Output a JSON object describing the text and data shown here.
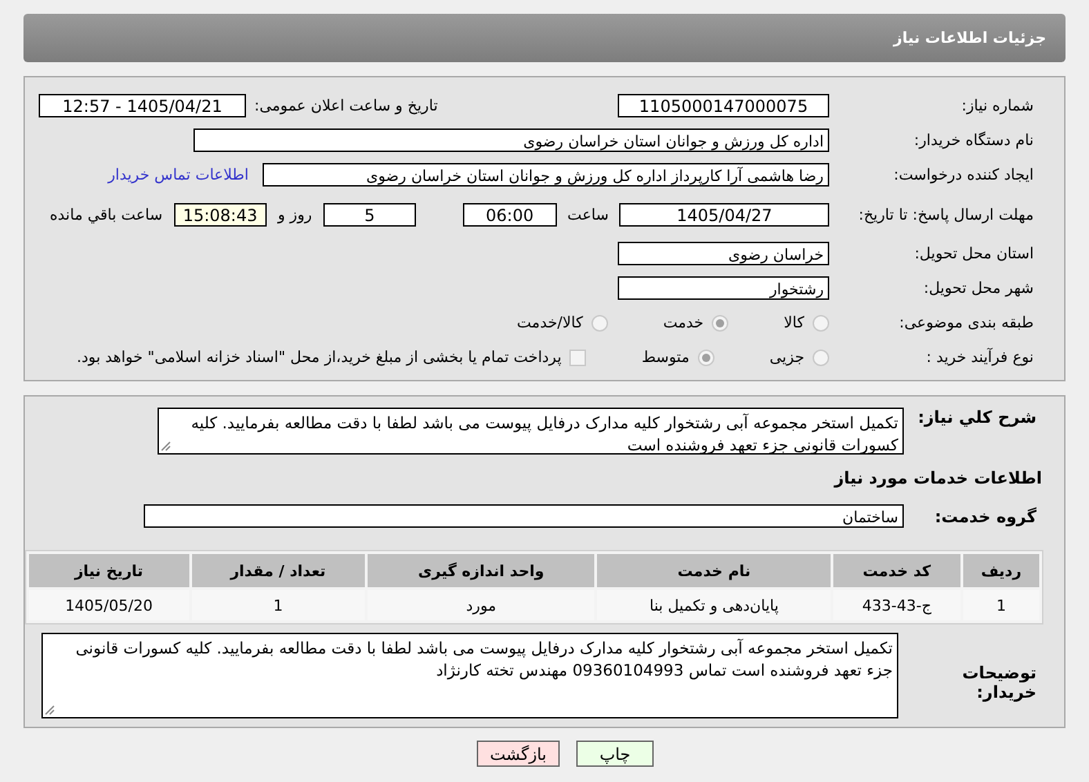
{
  "header": {
    "title": "جزئیات اطلاعات نیاز"
  },
  "need_number": {
    "label": "شماره نیاز:",
    "value": "1105000147000075"
  },
  "announce": {
    "label": "تاریخ و ساعت اعلان عمومی:",
    "value": "1405/04/21 - 12:57"
  },
  "buyer_org": {
    "label": "نام دستگاه خریدار:",
    "value": "اداره کل ورزش و جوانان استان خراسان رضوی"
  },
  "creator": {
    "label": "ایجاد کننده درخواست:",
    "value": "رضا هاشمی آرا کارپرداز اداره کل ورزش و جوانان استان خراسان رضوی",
    "link": "اطلاعات تماس خریدار"
  },
  "deadline": {
    "label": "مهلت ارسال پاسخ: تا تاریخ:",
    "date": "1405/04/27",
    "time_label": "ساعت",
    "time": "06:00",
    "days": "5",
    "days_label": "روز و",
    "remaining": "15:08:43",
    "remaining_label": "ساعت باقي مانده"
  },
  "province": {
    "label": "استان محل تحویل:",
    "value": "خراسان رضوی"
  },
  "city": {
    "label": "شهر محل تحویل:",
    "value": "رشتخوار"
  },
  "category": {
    "label": "طبقه بندی موضوعی:",
    "options": [
      {
        "label": "کالا",
        "selected": false
      },
      {
        "label": "خدمت",
        "selected": true
      },
      {
        "label": "کالا/خدمت",
        "selected": false
      }
    ]
  },
  "process": {
    "label": "نوع فرآیند خرید :",
    "options": [
      {
        "label": "جزیی",
        "selected": false
      },
      {
        "label": "متوسط",
        "selected": true
      }
    ],
    "treasury": {
      "checked": false,
      "text": "پرداخت تمام یا بخشی از مبلغ خرید،از محل \"اسناد خزانه اسلامی\" خواهد بود."
    }
  },
  "summary": {
    "label": "شرح کلي نیاز:",
    "text": "تکمیل استخر مجموعه آبی رشتخوار کلیه مدارک درفایل پیوست می باشد لطفا با دقت مطالعه بفرمایید. کلیه کسورات قانونی جزء تعهد فروشنده است"
  },
  "services_heading": "اطلاعات خدمات مورد نیاز",
  "service_group": {
    "label": "گروه خدمت:",
    "value": "ساختمان"
  },
  "table": {
    "columns": [
      "ردیف",
      "کد خدمت",
      "نام خدمت",
      "واحد اندازه گیری",
      "تعداد / مقدار",
      "تاریخ نیاز"
    ],
    "rows": [
      [
        "1",
        "ج-43-433",
        "پایان‌دهی و تکمیل بنا",
        "مورد",
        "1",
        "1405/05/20"
      ]
    ]
  },
  "buyer_notes": {
    "label": "توضیحات خریدار:",
    "text": "تکمیل استخر مجموعه آبی رشتخوار کلیه مدارک درفایل پیوست می باشد لطفا با دقت مطالعه بفرمایید. کلیه کسورات قانونی جزء تعهد فروشنده است تماس 09360104993 مهندس تخته کارنژاد"
  },
  "buttons": [
    {
      "label": "چاپ",
      "kind": "print"
    },
    {
      "label": "بازگشت",
      "kind": "back"
    }
  ]
}
